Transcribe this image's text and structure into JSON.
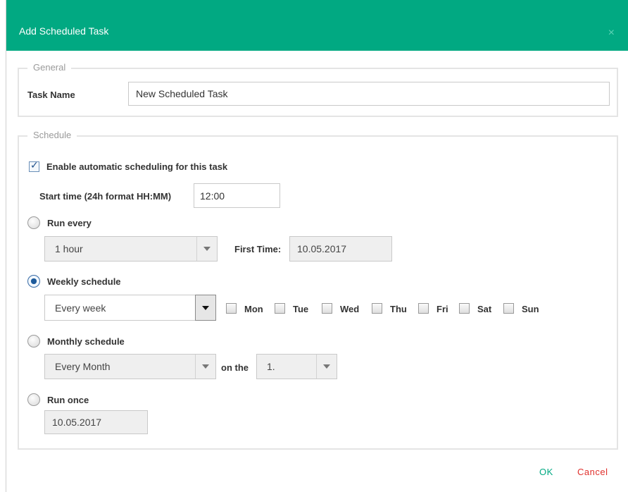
{
  "dialog": {
    "title": "Add Scheduled Task",
    "close_symbol": "×"
  },
  "general": {
    "legend": "General",
    "task_name_label": "Task Name",
    "task_name_value": "New Scheduled Task"
  },
  "schedule": {
    "legend": "Schedule",
    "enable_label": "Enable automatic scheduling for this task",
    "enable_checked": true,
    "start_time_label": "Start time (24h format HH:MM)",
    "start_time_value": "12:00",
    "run_every": {
      "label": "Run every",
      "interval": "1 hour",
      "first_time_label": "First Time:",
      "first_time_value": "10.05.2017"
    },
    "weekly": {
      "label": "Weekly schedule",
      "frequency": "Every week",
      "days": [
        "Mon",
        "Tue",
        "Wed",
        "Thu",
        "Fri",
        "Sat",
        "Sun"
      ]
    },
    "monthly": {
      "label": "Monthly schedule",
      "frequency": "Every Month",
      "on_the_label": "on the",
      "day": "1."
    },
    "run_once": {
      "label": "Run once",
      "date": "10.05.2017"
    },
    "selected_option": "weekly"
  },
  "footer": {
    "ok_label": "OK",
    "cancel_label": "Cancel"
  },
  "colors": {
    "header": "#01a982",
    "ok": "#01a982",
    "cancel": "#e0322e"
  }
}
